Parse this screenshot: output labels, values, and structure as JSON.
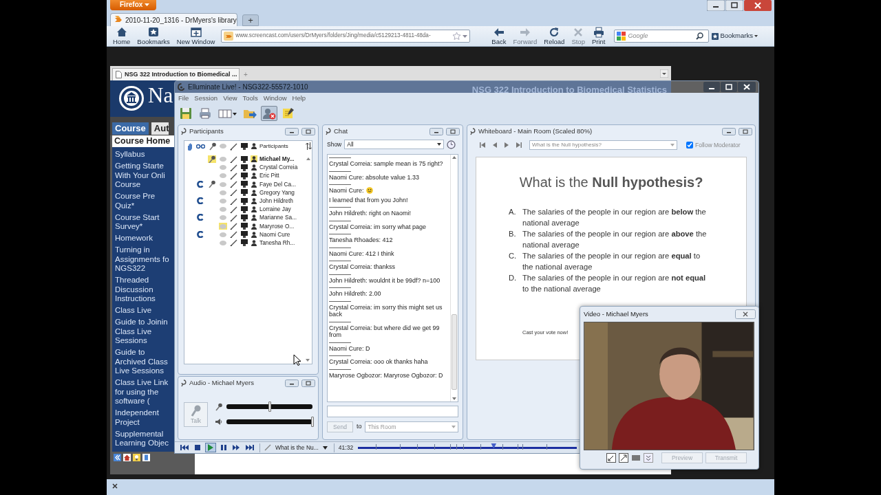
{
  "browser": {
    "menu_button": "Firefox",
    "tabs": [
      {
        "title": "2010-11-20_1316 - DrMyers's library",
        "selected": true
      }
    ],
    "new_tab": "+",
    "nav_left": [
      {
        "kind": "home",
        "label": "Home",
        "disabled": false
      },
      {
        "kind": "bookmarks",
        "label": "Bookmarks",
        "disabled": false
      },
      {
        "kind": "new_window",
        "label": "New Window",
        "disabled": false
      }
    ],
    "url": "www.screencast.com/users/DrMyers/folders/Jing/media/c5129213-4811-48da-",
    "nav_right": [
      {
        "kind": "back",
        "label": "Back",
        "disabled": false
      },
      {
        "kind": "forward",
        "label": "Forward",
        "disabled": true
      },
      {
        "kind": "reload",
        "label": "Reload",
        "disabled": false
      },
      {
        "kind": "stop",
        "label": "Stop",
        "disabled": true
      },
      {
        "kind": "print",
        "label": "Print",
        "disabled": false
      }
    ],
    "search": {
      "placeholder": "Google"
    },
    "bookmarks_menu": "Bookmarks"
  },
  "inner_browser": {
    "tab_title": "NSG 322 Introduction to Biomedical ...",
    "new_tab": "+"
  },
  "course_page": {
    "header_letters": "Na",
    "header_title": "NSG 322 Introduction to Biomedical Statistics",
    "tabs": [
      {
        "label": "Course",
        "selected": true
      },
      {
        "label": "Aut",
        "selected": false
      }
    ],
    "section": "Course Home",
    "menu": [
      "Syllabus",
      "Getting Starte\nWith Your Onli\nCourse",
      "Course Pre\nQuiz*",
      "Course Start\nSurvey*",
      "Homework",
      "Turning in\nAssignments fo\nNGS322",
      "Threaded\nDiscussion\nInstructions",
      "Class Live",
      "Guide to Joinin\nClass Live\nSessions",
      "Guide to\nArchived Class\nLive Sessions",
      "Class Live Link\nfor using the\nsoftware (",
      "Independent\nProject",
      "Supplemental\nLearning Objec"
    ]
  },
  "elluminate": {
    "title": "Elluminate Live! - NSG322-55572-1010",
    "menu": [
      "File",
      "Session",
      "View",
      "Tools",
      "Window",
      "Help"
    ],
    "toolbar": [
      {
        "kind": "save",
        "selected": false
      },
      {
        "kind": "print",
        "selected": false
      },
      {
        "kind": "layout",
        "selected": false
      },
      {
        "kind": "folder",
        "selected": false
      },
      {
        "kind": "person_x",
        "selected": true
      },
      {
        "kind": "note",
        "selected": false
      }
    ],
    "participants": {
      "title": "Participants",
      "column_label": "Participants",
      "rows": [
        {
          "name": "Michael My...",
          "moderator": true,
          "activity": false,
          "microphone": true,
          "talking": true,
          "bubble_highlighted": false
        },
        {
          "name": "Crystal Correia",
          "moderator": false,
          "activity": false,
          "microphone": false,
          "talking": false,
          "bubble_highlighted": false
        },
        {
          "name": "Eric Pitt",
          "moderator": false,
          "activity": false,
          "microphone": false,
          "talking": false,
          "bubble_highlighted": false
        },
        {
          "name": "Faye Del Ca...",
          "moderator": false,
          "activity": true,
          "microphone": true,
          "talking": false,
          "bubble_highlighted": false
        },
        {
          "name": "Gregory Yang",
          "moderator": false,
          "activity": false,
          "microphone": false,
          "talking": false,
          "bubble_highlighted": false
        },
        {
          "name": "John Hildreth",
          "moderator": false,
          "activity": true,
          "microphone": false,
          "talking": false,
          "bubble_highlighted": false
        },
        {
          "name": "Lorraine Jay",
          "moderator": false,
          "activity": false,
          "microphone": false,
          "talking": false,
          "bubble_highlighted": false
        },
        {
          "name": "Marianne Sa...",
          "moderator": false,
          "activity": true,
          "microphone": false,
          "talking": false,
          "bubble_highlighted": false
        },
        {
          "name": "Maryrose O...",
          "moderator": false,
          "activity": false,
          "microphone": false,
          "talking": false,
          "bubble_highlighted": true
        },
        {
          "name": "Naomi Cure",
          "moderator": false,
          "activity": true,
          "microphone": false,
          "talking": false,
          "bubble_highlighted": false
        },
        {
          "name": "Tanesha Rh...",
          "moderator": false,
          "activity": false,
          "microphone": false,
          "talking": false,
          "bubble_highlighted": false
        }
      ]
    },
    "audio": {
      "title": "Audio - Michael Myers",
      "talk": {
        "label": "Talk",
        "disabled": true
      },
      "sliders": [
        {
          "kind": "microphone",
          "level": 0.5
        },
        {
          "kind": "speaker",
          "level": 1
        }
      ]
    },
    "chat": {
      "title": "Chat",
      "show_label": "Show",
      "show_value": "All",
      "messages": [
        {
          "text": "Crystal Correia: sample mean is 75 right?",
          "smiley": false
        },
        {
          "text": "Naomi Cure: absolute value 1.33",
          "smiley": false
        },
        {
          "text": "Naomi Cure:",
          "smiley": true,
          "text_after": "I learned that from you John!"
        },
        {
          "text": "John Hildreth: right on Naomi!",
          "smiley": false
        },
        {
          "text": "Crystal Correia: im sorry what page",
          "smiley": false
        },
        {
          "text": "Tanesha Rhoades: 412",
          "smiley": false
        },
        {
          "text": "Naomi Cure: 412 I think",
          "smiley": false
        },
        {
          "text": "Crystal Correia: thankss",
          "smiley": false
        },
        {
          "text": "John Hildreth: wouldnt it be 99df? n=100",
          "smiley": false
        },
        {
          "text": "John Hildreth: 2.00",
          "smiley": false
        },
        {
          "text": "Crystal Correia: im sorry this might set us back",
          "smiley": false
        },
        {
          "text": "Crystal Correia: but where did we get 99 from",
          "smiley": false
        },
        {
          "text": "Naomi Cure: D",
          "smiley": false
        },
        {
          "text": "Crystal Correia: ooo ok thanks haha",
          "smiley": false
        },
        {
          "text": "Maryrose Ogbozor: Maryrose Ogbozor: D",
          "smiley": false
        }
      ],
      "send": {
        "label": "Send",
        "disabled": true
      },
      "to_label": "to",
      "to_value": "This Room"
    },
    "whiteboard": {
      "title": "Whiteboard - Main Room (Scaled 80%)",
      "page_select": "What is the Null hypothesis?",
      "follow_moderator": {
        "label": "Follow Moderator",
        "checked": true
      },
      "slide": {
        "title": "What is the **Null hypothesis?**",
        "options": [
          {
            "letter": "A.",
            "text": "The salaries of the people in our region are **below** the national average"
          },
          {
            "letter": "B.",
            "text": "The salaries of the people in our region are **above** the national average"
          },
          {
            "letter": "C.",
            "text": "The salaries of the people in our region are **equal** to the national average"
          },
          {
            "letter": "D.",
            "text": "The salaries of the people in our region are **not equal** to the national average"
          }
        ],
        "footer": "Cast your vote now!"
      }
    },
    "playback": {
      "buttons": [
        {
          "kind": "first",
          "selected": false
        },
        {
          "kind": "stop",
          "selected": false
        },
        {
          "kind": "play",
          "selected": true
        },
        {
          "kind": "pause",
          "selected": false
        },
        {
          "kind": "forward",
          "selected": false
        },
        {
          "kind": "last",
          "selected": false
        }
      ],
      "page": "What is the Nu...",
      "time": "41:32",
      "level": 0.62
    }
  },
  "video": {
    "title": "Video - Michael Myers",
    "buttons": [
      {
        "label": "Preview",
        "disabled": true
      },
      {
        "label": "Transmit",
        "disabled": true
      }
    ]
  }
}
